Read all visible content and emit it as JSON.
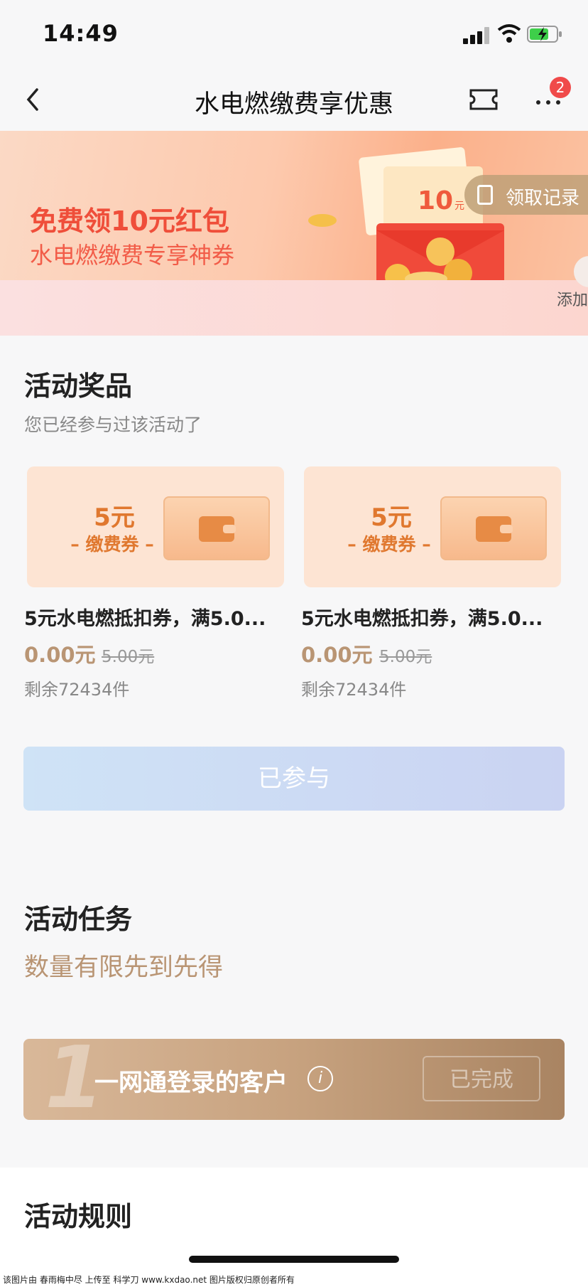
{
  "status_bar": {
    "time": "14:49"
  },
  "nav": {
    "title": "水电燃缴费享优惠",
    "more_badge": "2"
  },
  "banner": {
    "headline": "免费领10元红包",
    "subline": "水电燃缴费专享神券",
    "record_label": "领取记录",
    "add_label": "添加"
  },
  "prizes": {
    "title": "活动奖品",
    "subtitle": "您已经参与过该活动了",
    "items": [
      {
        "coupon_amount": "5元",
        "coupon_type": "– 缴费券 –",
        "name": "5元水电燃抵扣券，满5.0...",
        "price": "0.00元",
        "original_price": "5.00元",
        "stock": "剩余72434件"
      },
      {
        "coupon_amount": "5元",
        "coupon_type": "– 缴费券 –",
        "name": "5元水电燃抵扣券，满5.0...",
        "price": "0.00元",
        "original_price": "5.00元",
        "stock": "剩余72434件"
      }
    ],
    "joined_label": "已参与"
  },
  "tasks": {
    "title": "活动任务",
    "subtitle": "数量有限先到先得",
    "items": [
      {
        "number": "1",
        "label": "一网通登录的客户",
        "status": "已完成"
      }
    ]
  },
  "rules": {
    "title": "活动规则"
  },
  "watermark": "该图片由 春雨梅中尽 上传至 科学刀 www.kxdao.net 图片版权归原创者所有"
}
